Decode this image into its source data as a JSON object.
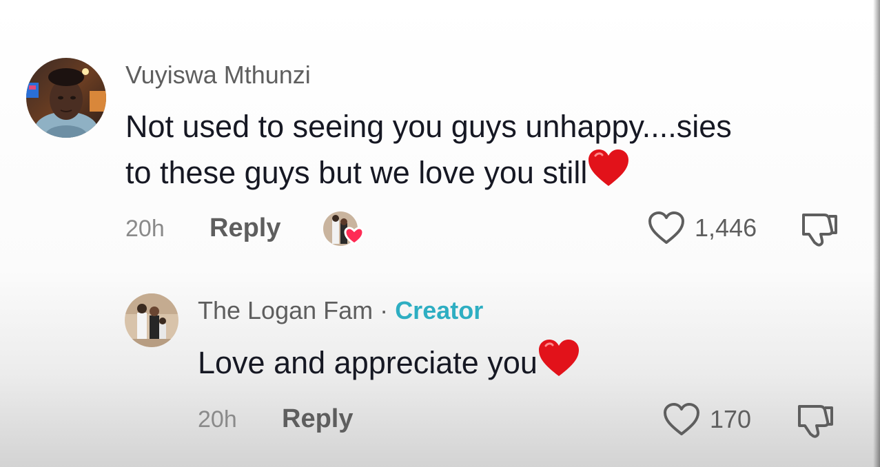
{
  "comments": [
    {
      "username": "Vuyiswa Mthunzi",
      "text_line1": "Not used to seeing you guys unhappy....sies",
      "text_line2": "to these guys but we love you still",
      "emoji": "heart-emoji",
      "time": "20h",
      "reply_label": "Reply",
      "likes": "1,446",
      "liked_by_creator": true
    }
  ],
  "replies": [
    {
      "username": "The Logan Fam",
      "separator": "·",
      "badge": "Creator",
      "text": "Love and appreciate you",
      "emoji": "heart-emoji",
      "time": "20h",
      "reply_label": "Reply",
      "likes": "170"
    }
  ],
  "colors": {
    "creator_badge": "#2eaec2",
    "heart_emoji": "#e2121a",
    "creator_like_heart": "#fe2c55"
  }
}
